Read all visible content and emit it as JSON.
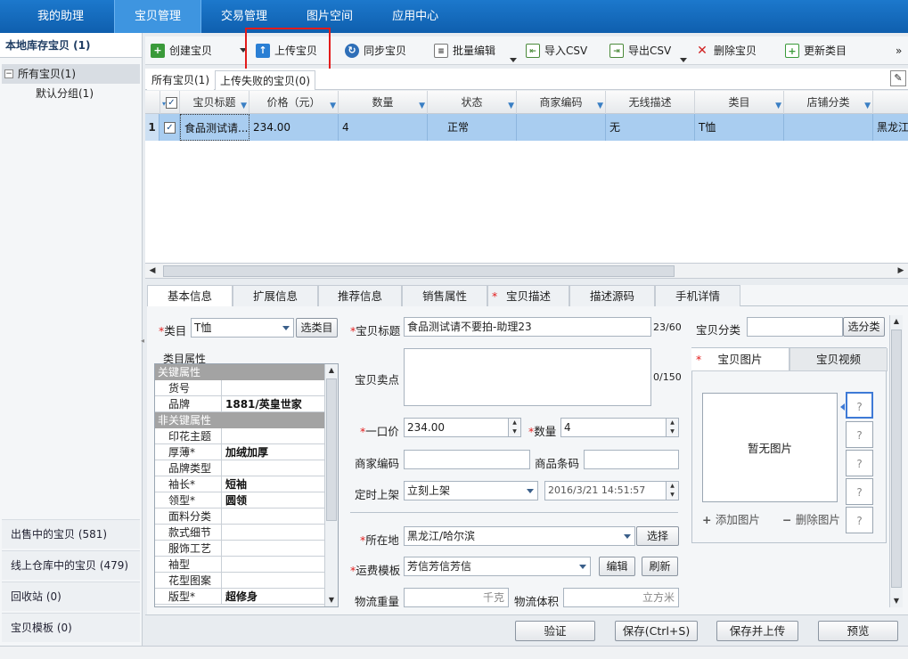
{
  "topnav": {
    "tabs": [
      "我的助理",
      "宝贝管理",
      "交易管理",
      "图片空间",
      "应用中心"
    ]
  },
  "sidebar": {
    "title": "本地库存宝贝 (1)",
    "tree_all": "所有宝贝(1)",
    "tree_child": "默认分组(1)",
    "bottom_items": [
      "出售中的宝贝 (581)",
      "线上仓库中的宝贝 (479)",
      "回收站 (0)",
      "宝贝模板 (0)"
    ]
  },
  "toolbar": {
    "create": "创建宝贝",
    "upload": "上传宝贝",
    "sync": "同步宝贝",
    "batch_edit": "批量编辑",
    "import_csv": "导入CSV",
    "export_csv": "导出CSV",
    "delete": "删除宝贝",
    "update_category": "更新类目",
    "more": "»"
  },
  "subtabs": {
    "all": "所有宝贝(1)",
    "failed": "上传失败的宝贝(0)"
  },
  "grid": {
    "columns": [
      "宝贝标题",
      "价格（元）",
      "数量",
      "状态",
      "商家编码",
      "无线描述",
      "类目",
      "店铺分类"
    ],
    "rows": [
      {
        "num": "1",
        "title": "食品测试请...",
        "price": "234.00",
        "qty": "4",
        "status": "正常",
        "code": "",
        "wireless": "无",
        "category": "T恤",
        "shop_cat": "",
        "extra": "黑龙江"
      }
    ]
  },
  "detail_tabs": [
    "基本信息",
    "扩展信息",
    "推荐信息",
    "销售属性",
    "宝贝描述",
    "描述源码",
    "手机详情"
  ],
  "form": {
    "category_label": "类目",
    "category_value": "T恤",
    "choose_category_btn": "选类目",
    "attr_group_label": "类目属性",
    "key_attrs_header": "关键属性",
    "key_attrs": [
      {
        "k": "货号",
        "v": ""
      },
      {
        "k": "品牌",
        "v": "1881/英皇世家"
      }
    ],
    "nonkey_attrs_header": "非关键属性",
    "nonkey_attrs": [
      {
        "k": "印花主题",
        "v": ""
      },
      {
        "k": "厚薄*",
        "v": "加绒加厚"
      },
      {
        "k": "品牌类型",
        "v": ""
      },
      {
        "k": "袖长*",
        "v": "短袖"
      },
      {
        "k": "领型*",
        "v": "圆领"
      },
      {
        "k": "面料分类",
        "v": ""
      },
      {
        "k": "款式细节",
        "v": ""
      },
      {
        "k": "服饰工艺",
        "v": ""
      },
      {
        "k": "袖型",
        "v": ""
      },
      {
        "k": "花型图案",
        "v": ""
      },
      {
        "k": "版型*",
        "v": "超修身"
      }
    ],
    "title_label": "宝贝标题",
    "title_value": "食品测试请不要拍-助理23",
    "title_count": "23/60",
    "selling_label": "宝贝卖点",
    "selling_count": "0/150",
    "price_label": "一口价",
    "price_value": "234.00",
    "qty_label": "数量",
    "qty_value": "4",
    "merchant_code_label": "商家编码",
    "barcode_label": "商品条码",
    "schedule_label": "定时上架",
    "schedule_value": "立刻上架",
    "schedule_time": "2016/3/21 14:51:57",
    "location_label": "所在地",
    "location_value": "黑龙江/哈尔滨",
    "choose_btn": "选择",
    "shipping_label": "运费模板",
    "shipping_value": "芳信芳信芳信",
    "edit_btn": "编辑",
    "refresh_btn": "刷新",
    "weight_label": "物流重量",
    "weight_unit": "千克",
    "volume_label": "物流体积",
    "volume_unit": "立方米",
    "shop_cat_label": "宝贝分类",
    "shop_cat_btn": "选分类"
  },
  "images": {
    "tab_images": "宝贝图片",
    "tab_video": "宝贝视频",
    "no_image": "暂无图片",
    "add": "添加图片",
    "delete": "删除图片",
    "placeholder": "?"
  },
  "footer": {
    "verify": "验证",
    "save": "保存(Ctrl+S)",
    "save_upload": "保存并上传",
    "preview": "预览"
  },
  "colors": {
    "topbar": "#1565b8",
    "active_tab": "#3e95e0",
    "selected_row": "#a9cdf0",
    "highlight": "#e31b1b",
    "required": "#e31b1b"
  }
}
